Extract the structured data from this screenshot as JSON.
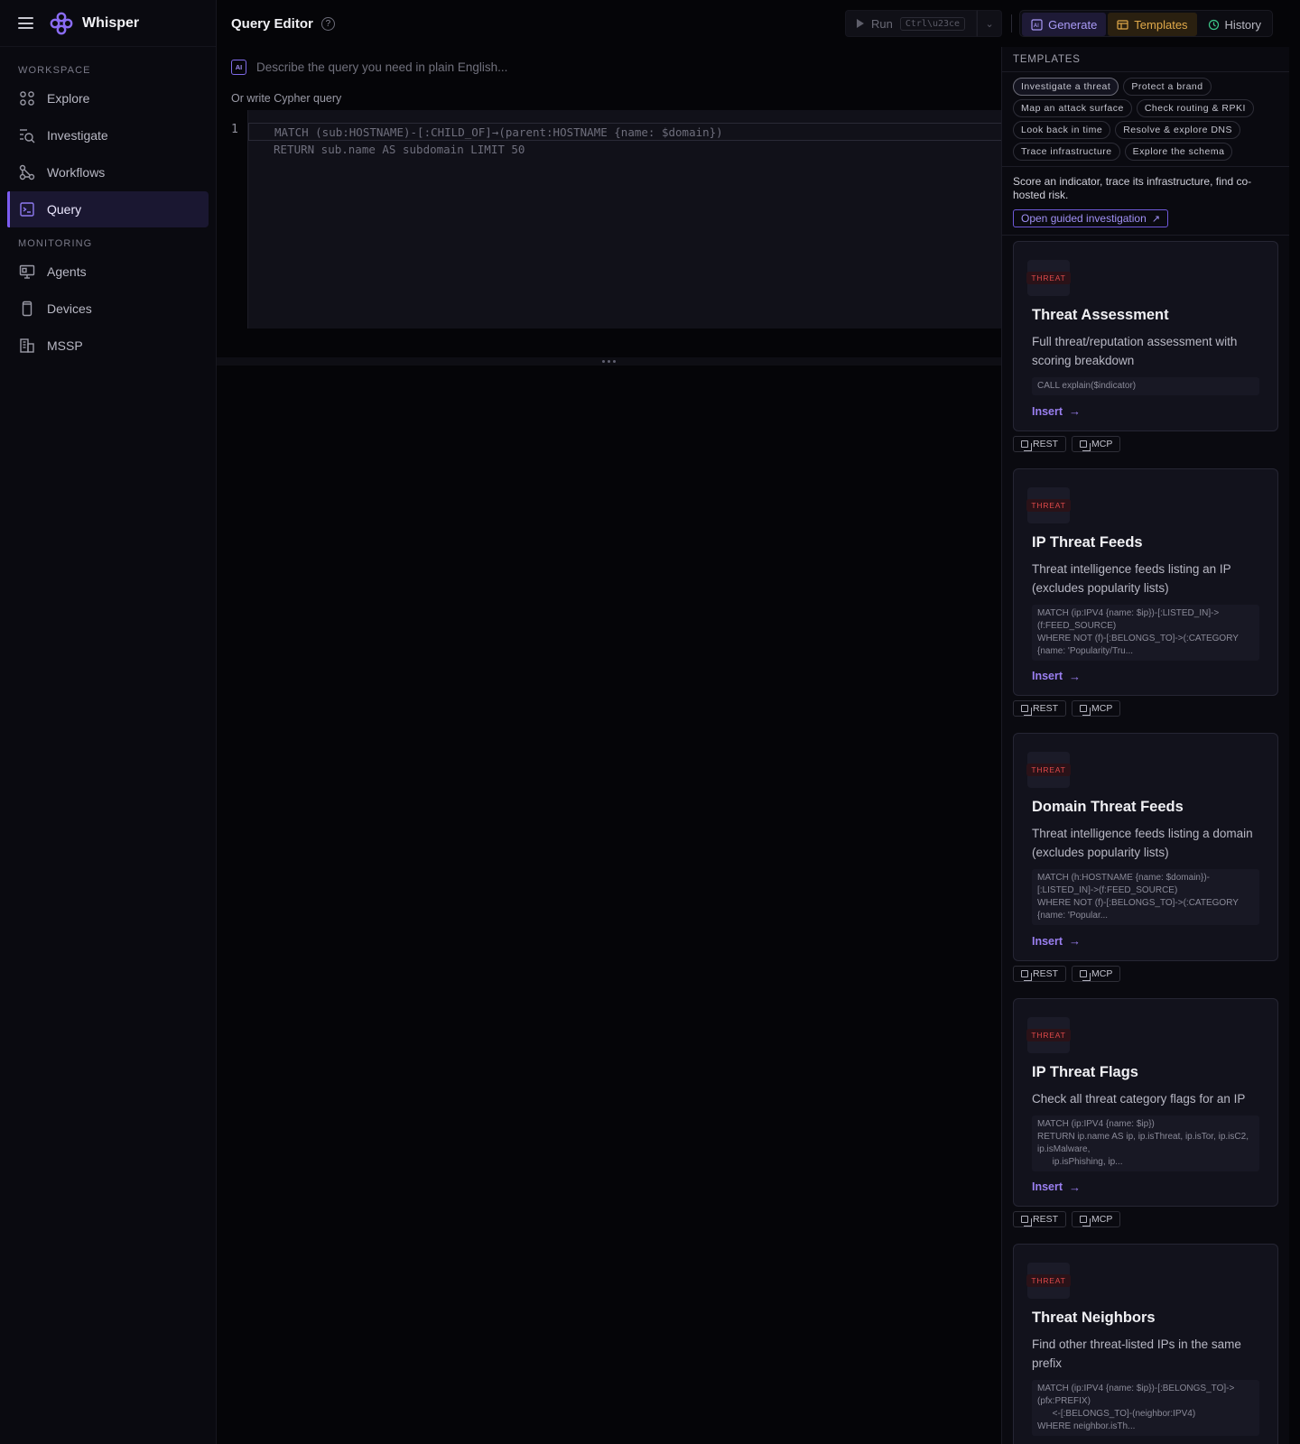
{
  "app": {
    "name": "Whisper",
    "page_title": "Query Editor"
  },
  "sidebar": {
    "sections": [
      {
        "label": "WORKSPACE",
        "items": [
          {
            "label": "Explore",
            "icon": "explore-icon"
          },
          {
            "label": "Investigate",
            "icon": "investigate-icon"
          },
          {
            "label": "Workflows",
            "icon": "workflows-icon"
          },
          {
            "label": "Query",
            "icon": "query-icon",
            "active": true
          }
        ]
      },
      {
        "label": "MONITORING",
        "items": [
          {
            "label": "Agents",
            "icon": "agents-icon"
          },
          {
            "label": "Devices",
            "icon": "devices-icon"
          },
          {
            "label": "MSSP",
            "icon": "mssp-icon"
          }
        ]
      }
    ]
  },
  "toolbar": {
    "run_label": "Run",
    "run_shortcut": "Ctrl\\u23ce",
    "generate_label": "Generate",
    "templates_label": "Templates",
    "history_label": "History"
  },
  "editor": {
    "ai_badge": "AI",
    "ai_placeholder": "Describe the query you need in plain English...",
    "cypher_label": "Or write Cypher query",
    "line_number": "1",
    "code_lines": [
      "MATCH (sub:HOSTNAME)-[:CHILD_OF]→(parent:HOSTNAME {name: $domain})",
      "RETURN sub.name AS subdomain LIMIT 50"
    ]
  },
  "templates_panel": {
    "title": "TEMPLATES",
    "chips": [
      {
        "label": "Investigate a threat",
        "active": true
      },
      {
        "label": "Protect a brand"
      },
      {
        "label": "Map an attack surface"
      },
      {
        "label": "Check routing & RPKI"
      },
      {
        "label": "Look back in time"
      },
      {
        "label": "Resolve & explore DNS"
      },
      {
        "label": "Trace infrastructure"
      },
      {
        "label": "Explore the schema"
      }
    ],
    "guide_text": "Score an indicator, trace its infrastructure, find co-hosted risk.",
    "guide_button": "Open guided investigation",
    "insert_label": "Insert",
    "rest_label": "REST",
    "mcp_label": "MCP",
    "cards": [
      {
        "badge": "THREAT",
        "title": "Threat Assessment",
        "description": "Full threat/reputation assessment with scoring breakdown",
        "code": "CALL explain($indicator)"
      },
      {
        "badge": "THREAT",
        "title": "IP Threat Feeds",
        "description": "Threat intelligence feeds listing an IP (excludes popularity lists)",
        "code": "MATCH (ip:IPV4 {name: $ip})-[:LISTED_IN]->(f:FEED_SOURCE)\nWHERE NOT (f)-[:BELONGS_TO]->(:CATEGORY {name: 'Popularity/Tru..."
      },
      {
        "badge": "THREAT",
        "title": "Domain Threat Feeds",
        "description": "Threat intelligence feeds listing a domain (excludes popularity lists)",
        "code": "MATCH (h:HOSTNAME {name: $domain})-[:LISTED_IN]->(f:FEED_SOURCE)\nWHERE NOT (f)-[:BELONGS_TO]->(:CATEGORY {name: 'Popular..."
      },
      {
        "badge": "THREAT",
        "title": "IP Threat Flags",
        "description": "Check all threat category flags for an IP",
        "code": "MATCH (ip:IPV4 {name: $ip})\nRETURN ip.name AS ip, ip.isThreat, ip.isTor, ip.isC2, ip.isMalware,\n      ip.isPhishing, ip..."
      },
      {
        "badge": "THREAT",
        "title": "Threat Neighbors",
        "description": "Find other threat-listed IPs in the same prefix",
        "code": "MATCH (ip:IPV4 {name: $ip})-[:BELONGS_TO]->(pfx:PREFIX)\n      <-[:BELONGS_TO]-(neighbor:IPV4)\nWHERE neighbor.isTh..."
      }
    ]
  }
}
